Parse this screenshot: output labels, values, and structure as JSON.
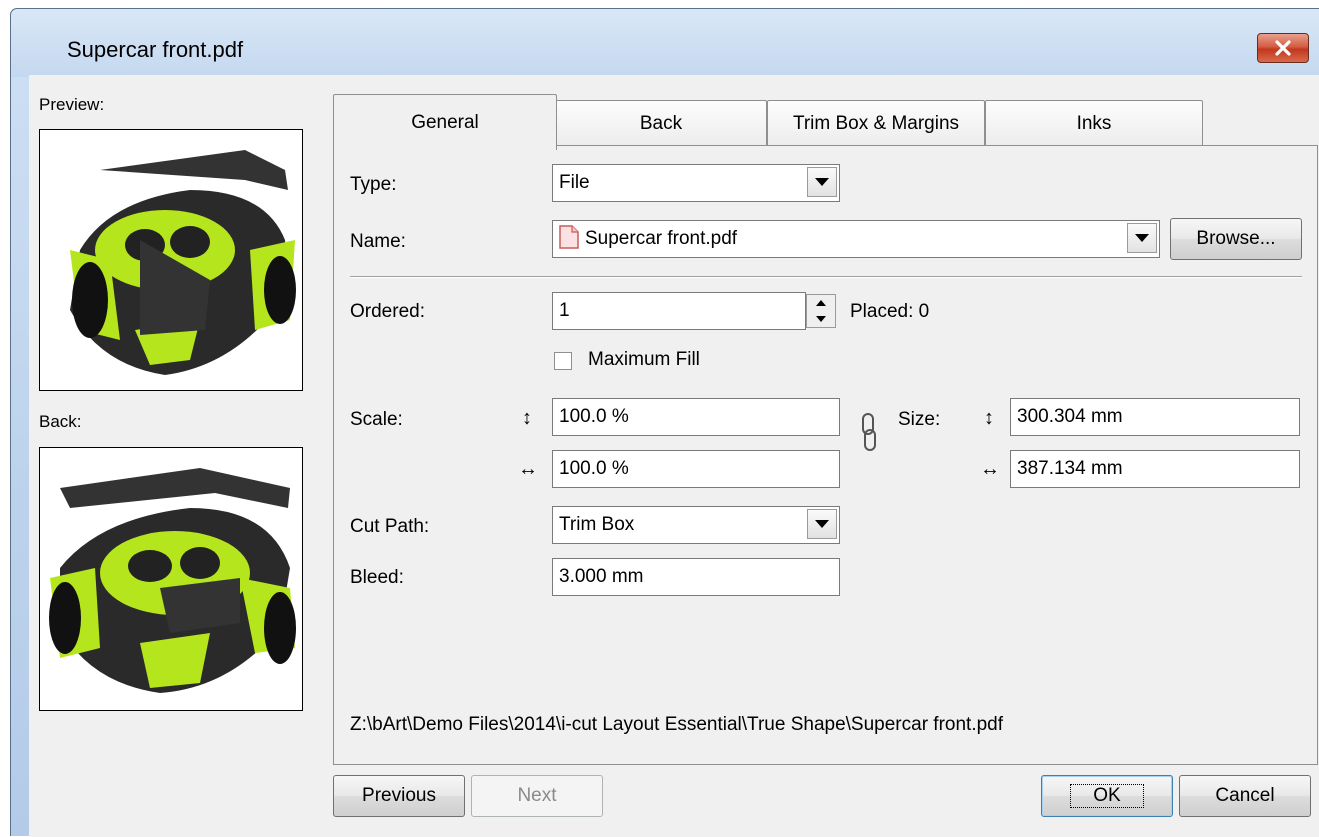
{
  "window": {
    "title": "Supercar front.pdf"
  },
  "side": {
    "preview_label": "Preview:",
    "back_label": "Back:"
  },
  "tabs": [
    {
      "label": "General",
      "active": true
    },
    {
      "label": "Back",
      "active": false
    },
    {
      "label": "Trim Box & Margins",
      "active": false
    },
    {
      "label": "Inks",
      "active": false
    }
  ],
  "form": {
    "type_label": "Type:",
    "type_value": "File",
    "name_label": "Name:",
    "name_value": "Supercar front.pdf",
    "browse_label": "Browse...",
    "ordered_label": "Ordered:",
    "ordered_value": "1",
    "placed_label": "Placed: 0",
    "max_fill_label": "Maximum Fill",
    "max_fill_checked": false,
    "scale_label": "Scale:",
    "scale_v": "100.0 %",
    "scale_h": "100.0 %",
    "size_label": "Size:",
    "size_v": "300.304 mm",
    "size_h": "387.134 mm",
    "cut_path_label": "Cut Path:",
    "cut_path_value": "Trim Box",
    "bleed_label": "Bleed:",
    "bleed_value": "3.000 mm",
    "file_path": "Z:\\bArt\\Demo Files\\2014\\i-cut Layout Essential\\True Shape\\Supercar front.pdf"
  },
  "buttons": {
    "previous": "Previous",
    "next": "Next",
    "ok": "OK",
    "cancel": "Cancel"
  },
  "icons": {
    "vertical_arrow": "↕",
    "horizontal_arrow": "↔",
    "close": "close-icon",
    "link": "chain-link-icon",
    "pdf": "pdf-file-icon"
  },
  "colors": {
    "title_bg": "#c4d8ef",
    "close_red": "#c2381d",
    "car_accent": "#b5e61d"
  }
}
